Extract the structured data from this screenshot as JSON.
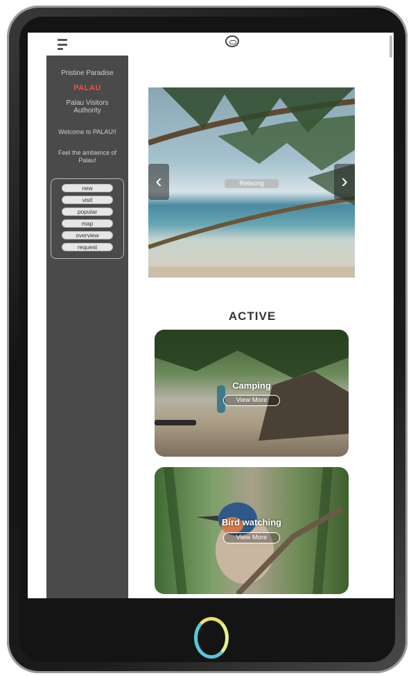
{
  "header": {
    "menu_icon": "hamburger-icon",
    "logo_icon": "palau-logo-icon"
  },
  "sidebar": {
    "tagline": "Pristine Paradise",
    "brand": "PALAU",
    "authority": "Palau Visitors Authority",
    "welcome": "Welcome to PALAU!!",
    "ambience": "Feel the ambience of Palau!",
    "nav": [
      {
        "label": "new"
      },
      {
        "label": "visit"
      },
      {
        "label": "popular"
      },
      {
        "label": "map"
      },
      {
        "label": "overview"
      },
      {
        "label": "request"
      }
    ]
  },
  "hero": {
    "caption": "Relaxing",
    "prev_icon": "chevron-left-icon",
    "next_icon": "chevron-right-icon"
  },
  "main": {
    "section_title": "ACTIVE",
    "cards": [
      {
        "title": "Camping",
        "button": "View More"
      },
      {
        "title": "Bird watching",
        "button": "View More"
      }
    ]
  },
  "colors": {
    "brand": "#ff4a4a",
    "sidebar_bg": "#4a4a4a",
    "home_ring": "#57c9d9"
  }
}
